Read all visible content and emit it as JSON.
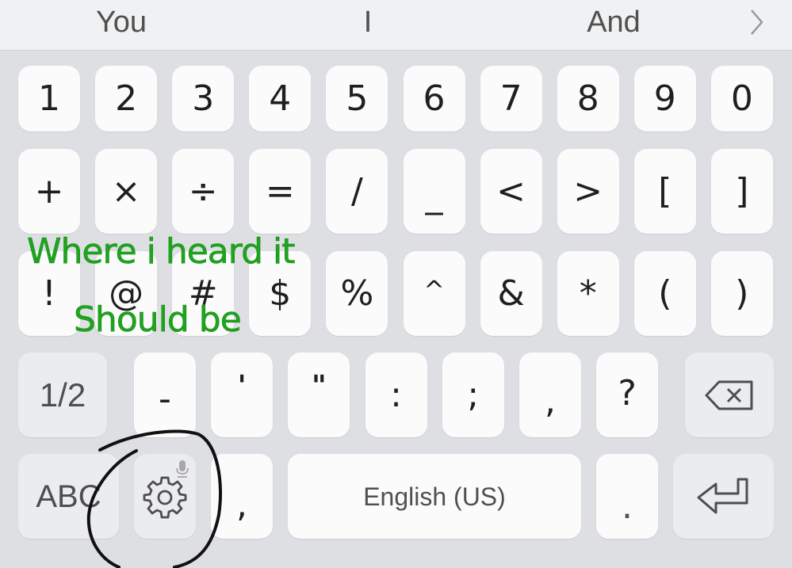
{
  "suggestions": {
    "items": [
      "You",
      "I",
      "And"
    ],
    "more_icon": "chevron-right-icon"
  },
  "keyboard": {
    "rows": [
      [
        "1",
        "2",
        "3",
        "4",
        "5",
        "6",
        "7",
        "8",
        "9",
        "0"
      ],
      [
        "+",
        "×",
        "÷",
        "=",
        "/",
        "_",
        "<",
        ">",
        "[",
        "]"
      ],
      [
        "!",
        "@",
        "#",
        "$",
        "%",
        "^",
        "&",
        "*",
        "(",
        ")"
      ],
      [
        "-",
        "'",
        "\"",
        ":",
        ";",
        ",",
        "?"
      ]
    ],
    "page_toggle_label": "1/2",
    "backspace_icon": "backspace-icon",
    "abc_label": "ABC",
    "settings_icon": "gear-icon",
    "mic_hint_icon": "microphone-icon",
    "comma_label": ",",
    "space_label": "English (US)",
    "period_label": ".",
    "enter_icon": "enter-icon"
  },
  "annotations": {
    "heard_text": "Where i  heard it",
    "should_text": "Should be"
  },
  "colors": {
    "annotation_green": "#1ea51e",
    "ink": "#111111",
    "key_bg": "#fbfbfb",
    "func_key_bg": "#ebecef",
    "board_bg": "#dedfe3"
  }
}
